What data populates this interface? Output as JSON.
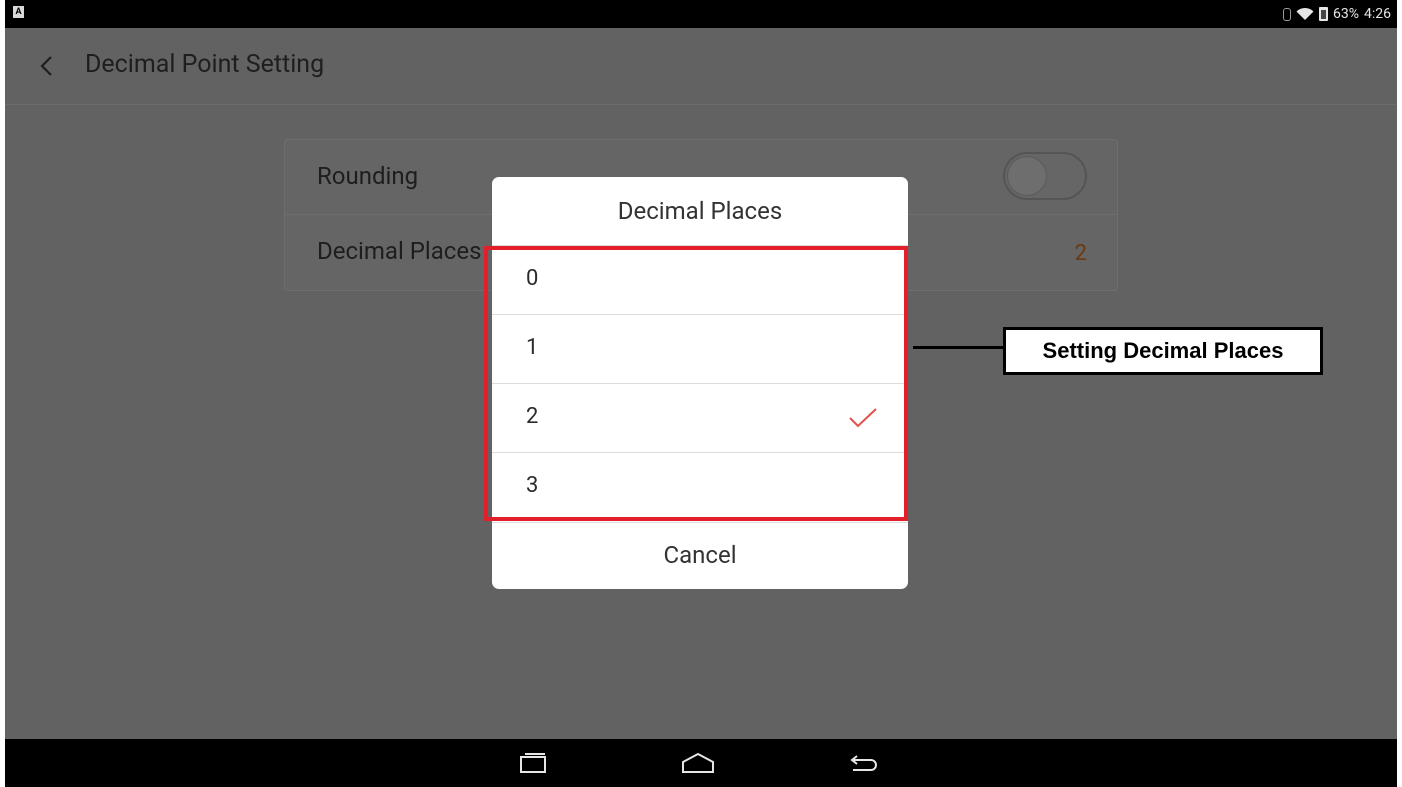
{
  "status_bar": {
    "battery_percent": "63%",
    "time": "4:26",
    "left_icon_letter": "A",
    "icons": [
      "bluetooth-icon",
      "wifi-icon",
      "battery-icon"
    ]
  },
  "header": {
    "title": "Decimal Point Setting",
    "back_icon": "chevron-left-icon"
  },
  "settings": {
    "rounding": {
      "label": "Rounding",
      "enabled": false
    },
    "decimal_places": {
      "label": "Decimal Places",
      "value": "2"
    }
  },
  "dialog": {
    "title": "Decimal Places",
    "options": [
      "0",
      "1",
      "2",
      "3"
    ],
    "selected": "2",
    "cancel_label": "Cancel"
  },
  "annotation": {
    "label": "Setting Decimal Places",
    "highlight_color": "#e3202a"
  },
  "nav_bar": {
    "buttons": [
      "recent-apps-icon",
      "home-icon",
      "back-icon"
    ]
  },
  "colors": {
    "dim_overlay": "#626262",
    "accent_check": "#e0524a",
    "value_text": "#6a3a12"
  }
}
